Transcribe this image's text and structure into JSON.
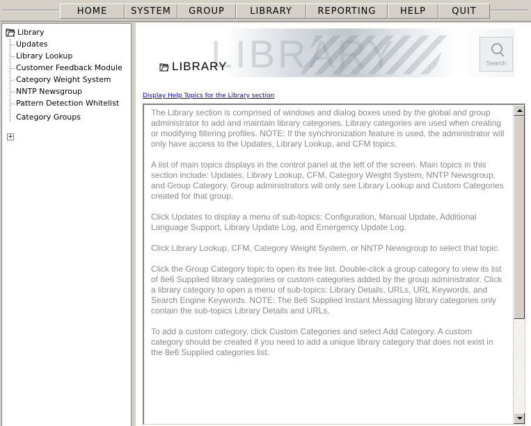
{
  "menu": {
    "items": [
      "HOME",
      "SYSTEM",
      "GROUP",
      "LIBRARY",
      "REPORTING",
      "HELP",
      "QUIT"
    ]
  },
  "tree": {
    "root": "Library",
    "children": [
      "Updates",
      "Library Lookup",
      "Customer Feedback Module",
      "Category Weight System",
      "NNTP Newsgroup",
      "Pattern Detection Whitelist"
    ],
    "groups": "Category Groups",
    "expander": "+"
  },
  "banner": {
    "title": "LIBRARY",
    "watermark": "LIBRARY",
    "search_label": "Search"
  },
  "help_link": "Display Help Topics for the Library section",
  "content": {
    "paragraphs": [
      "The Library section is comprised of windows and dialog boxes used by the global and group administrator to add and maintain library categories. Library categories are used when creating or modifying filtering profiles. NOTE: If the synchronization feature is used, the administrator will only have access to the Updates, Library Lookup, and CFM topics.",
      "A list of main topics displays in the control panel at the left of the screen. Main topics in this section include: Updates, Library Lookup, CFM, Category Weight System, NNTP Newsgroup, and Group Category. Group administrators will only see Library Lookup and Custom Categories created for that group.",
      "Click Updates to display a menu of sub-topics: Configuration, Manual Update, Additional Language Support, Library Update Log, and Emergency Update Log.",
      "Click Library Lookup, CFM, Category Weight System, or NNTP Newsgroup to select that topic.",
      "Click the Group Category topic to open its tree list. Double-click a group category to view its list of 8e6 Supplied library categories or custom categories added by the group administrator. Click a library category to open a menu of sub-topics: Library Details, URLs, URL Keywords, and Search Engine Keywords. NOTE: The 8e6 Supplied Instant Messaging library categories only contain the sub-topics Library Details and URLs.",
      "To add a custom category, click Custom Categories and select Add Category. A custom category should be created if you need to add a unique library category that does not exist in the 8e6 Supplied categories list."
    ]
  },
  "colors": {
    "chrome": "#d4d0c8",
    "body_text": "#8a8a8a",
    "link": "#0000cc"
  },
  "icons": [
    "folder-icon",
    "search-icon",
    "expand-plus-icon",
    "scroll-up-arrow-icon",
    "scroll-down-arrow-icon"
  ]
}
